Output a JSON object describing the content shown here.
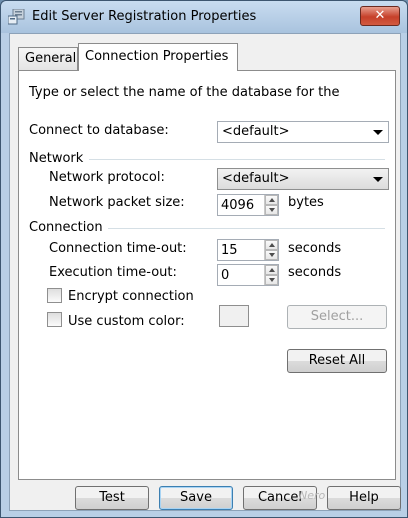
{
  "window": {
    "title": "Edit Server Registration Properties",
    "close_label": "✕"
  },
  "tabs": [
    {
      "label": "General",
      "active": false
    },
    {
      "label": "Connection Properties",
      "active": true
    }
  ],
  "panel": {
    "intro": "Type or select the name of the database for the",
    "connect_label": "Connect to database:",
    "connect_value": "<default>",
    "network_header": "Network",
    "protocol_label": "Network protocol:",
    "protocol_value": "<default>",
    "packet_label": "Network packet size:",
    "packet_value": "4096",
    "packet_unit": "bytes",
    "connection_header": "Connection",
    "conn_timeout_label": "Connection time-out:",
    "conn_timeout_value": "15",
    "conn_timeout_unit": "seconds",
    "exec_timeout_label": "Execution time-out:",
    "exec_timeout_value": "0",
    "exec_timeout_unit": "seconds",
    "encrypt_label": "Encrypt connection",
    "custom_color_label": "Use custom color:",
    "select_label": "Select...",
    "reset_label": "Reset All"
  },
  "footer": {
    "test_label": "Test",
    "save_label": "Save",
    "cancel_label": "Cancel",
    "help_label": "Help"
  },
  "watermark": "Nero"
}
